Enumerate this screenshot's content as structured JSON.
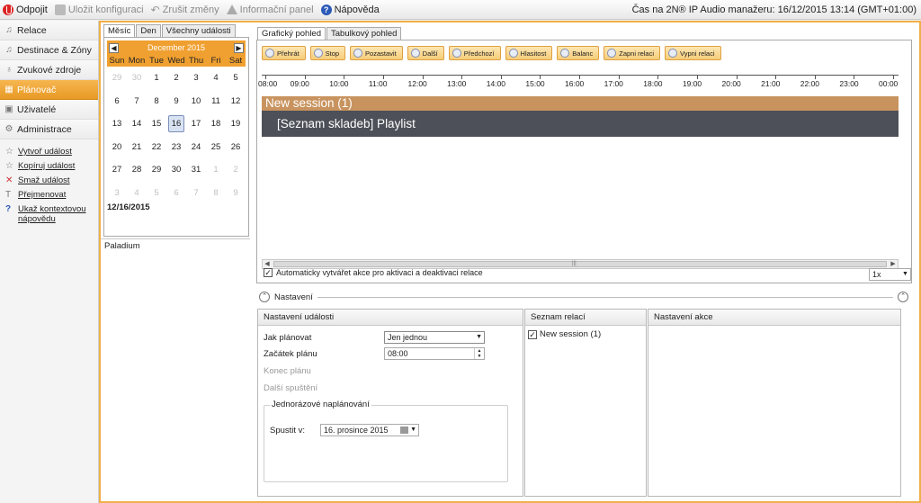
{
  "toolbar": {
    "disconnect": "Odpojit",
    "save_config": "Uložit konfiguraci",
    "undo_changes": "Zrušit změny",
    "info_panel": "Informační panel",
    "help": "Nápověda",
    "time_label": "Čas na 2N® IP Audio manažeru:",
    "time_value": "16/12/2015 13:14 (GMT+01:00)"
  },
  "sidebar": {
    "items": [
      {
        "label": "Relace",
        "icon": "music-note-icon"
      },
      {
        "label": "Destinace & Zóny",
        "icon": "music-note-icon"
      },
      {
        "label": "Zvukové zdroje",
        "icon": "microphone-icon"
      },
      {
        "label": "Plánovač",
        "icon": "calendar-icon"
      },
      {
        "label": "Uživatelé",
        "icon": "users-icon"
      },
      {
        "label": "Administrace",
        "icon": "gear-icon"
      }
    ],
    "actions": [
      {
        "label": "Vytvoř událost",
        "icon": "star-icon"
      },
      {
        "label": "Kopíruj událost",
        "icon": "star-icon"
      },
      {
        "label": "Smaž událost",
        "icon": "delete-icon"
      },
      {
        "label": "Přejmenovat",
        "icon": "rename-icon"
      },
      {
        "label": "Ukaž kontextovou nápovědu",
        "icon": "help-icon"
      }
    ]
  },
  "calendar": {
    "tabs": [
      "Měsíc",
      "Den",
      "Všechny události"
    ],
    "month_title": "December 2015",
    "prev": "◀",
    "next": "▶",
    "dow": [
      "Sun",
      "Mon",
      "Tue",
      "Wed",
      "Thu",
      "Fri",
      "Sat"
    ],
    "days": [
      [
        "29",
        "30",
        "1",
        "2",
        "3",
        "4",
        "5"
      ],
      [
        "6",
        "7",
        "8",
        "9",
        "10",
        "11",
        "12"
      ],
      [
        "13",
        "14",
        "15",
        "16",
        "17",
        "18",
        "19"
      ],
      [
        "20",
        "21",
        "22",
        "23",
        "24",
        "25",
        "26"
      ],
      [
        "27",
        "28",
        "29",
        "30",
        "31",
        "1",
        "2"
      ],
      [
        "3",
        "4",
        "5",
        "6",
        "7",
        "8",
        "9"
      ]
    ],
    "selected": "12/16/2015",
    "location": "Paladium"
  },
  "view": {
    "tabs": [
      "Grafický pohled",
      "Tabulkový pohled"
    ],
    "controls": [
      "Přehrát",
      "Stop",
      "Pozastavit",
      "Další",
      "Předchozí",
      "Hlasitost",
      "Balanc",
      "Zapni relaci",
      "Vypni relaci"
    ],
    "hours": [
      "08:00",
      "09:00",
      "10:00",
      "11:00",
      "12:00",
      "13:00",
      "14:00",
      "15:00",
      "16:00",
      "17:00",
      "18:00",
      "19:00",
      "20:00",
      "21:00",
      "22:00",
      "23:00",
      "00:00"
    ],
    "session": "New session (1)",
    "playlist": "[Seznam skladeb] Playlist",
    "auto_label": "Automaticky vytvářet akce pro aktivaci a deaktivaci relace",
    "auto_check": "✓",
    "zoom": "1x"
  },
  "settings": {
    "title": "Nastavení",
    "event_panel": {
      "title": "Nastavení události",
      "how_label": "Jak plánovat",
      "how_value": "Jen jednou",
      "start_label": "Začátek plánu",
      "start_value": "08:00",
      "end_label": "Konec plánu",
      "next_label": "Další spuštění",
      "group_title": "Jednorázové naplánování",
      "run_label": "Spustit v:",
      "run_value": "16. prosince  2015"
    },
    "relations_panel": {
      "title": "Seznam relací",
      "item": "New session (1)",
      "check": "✓"
    },
    "action_panel": {
      "title": "Nastavení akce"
    }
  }
}
